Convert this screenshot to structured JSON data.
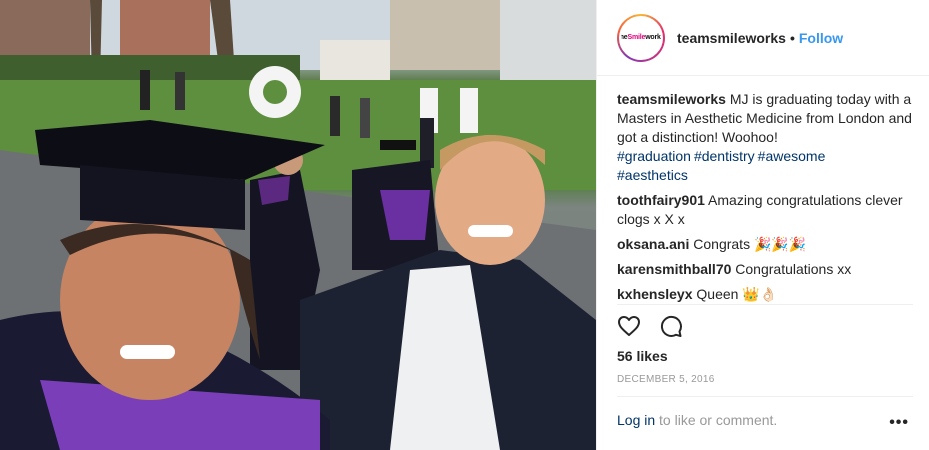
{
  "post": {
    "username": "teamsmileworks",
    "separator": "•",
    "follow_label": "Follow",
    "avatar_text_a": "the",
    "avatar_text_b": "Smile",
    "avatar_text_c": "works"
  },
  "comments": [
    {
      "user": "teamsmileworks",
      "text": "MJ is graduating today with a Masters in Aesthetic Medicine from London and got a distinction! Woohoo!",
      "tags": [
        "#graduation",
        "#dentistry",
        "#awesome",
        "#aesthetics"
      ]
    },
    {
      "user": "toothfairy901",
      "text": "Amazing congratulations clever clogs x X x"
    },
    {
      "user": "oksana.ani",
      "text": "Congrats 🎉🎉🎉"
    },
    {
      "user": "karensmithball70",
      "text": "Congratulations xx"
    },
    {
      "user": "kxhensleyx",
      "text": "Queen 👑👌🏻"
    }
  ],
  "stats": {
    "likes": "56 likes",
    "date": "DECEMBER 5, 2016"
  },
  "footer": {
    "login": "Log in",
    "prompt": " to like or comment.",
    "more": "•••"
  },
  "icons": {
    "like": "heart-icon",
    "comment": "comment-icon",
    "more": "more-options-icon"
  },
  "colors": {
    "link_blue": "#3897f0",
    "hashtag": "#003569",
    "muted": "#999999",
    "text": "#262626"
  }
}
